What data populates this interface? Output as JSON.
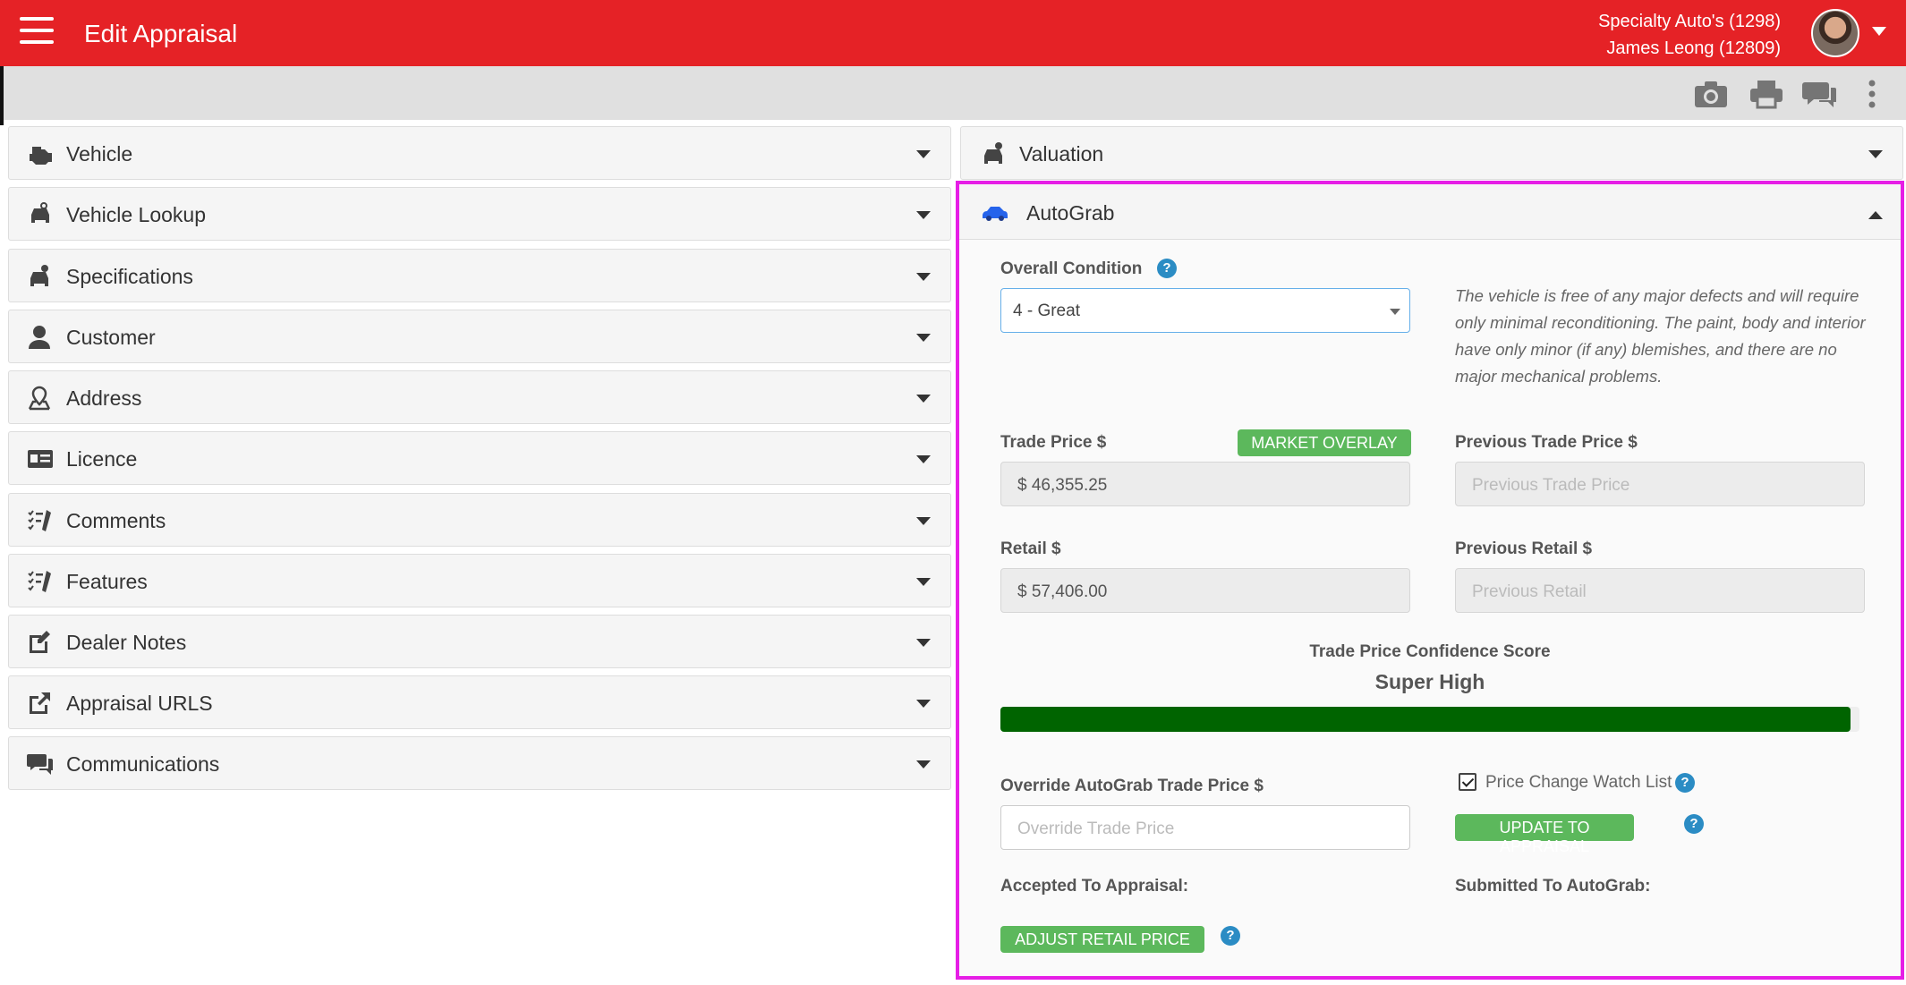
{
  "header": {
    "title": "Edit Appraisal",
    "dealer": "Specialty Auto's (1298)",
    "user": "James Leong (12809)"
  },
  "toolbar": {
    "icons": [
      "camera-icon",
      "print-icon",
      "chat-icon",
      "more-vert-icon"
    ]
  },
  "sidebar": {
    "items": [
      {
        "label": "Vehicle",
        "icon": "engine-icon"
      },
      {
        "label": "Vehicle Lookup",
        "icon": "car-search-icon"
      },
      {
        "label": "Specifications",
        "icon": "car-gear-icon"
      },
      {
        "label": "Customer",
        "icon": "user-icon"
      },
      {
        "label": "Address",
        "icon": "location-icon"
      },
      {
        "label": "Licence",
        "icon": "id-card-icon"
      },
      {
        "label": "Comments",
        "icon": "checklist-pen-icon"
      },
      {
        "label": "Features",
        "icon": "checklist-pen-icon"
      },
      {
        "label": "Dealer Notes",
        "icon": "edit-note-icon"
      },
      {
        "label": "Appraisal URLS",
        "icon": "external-link-icon"
      },
      {
        "label": "Communications",
        "icon": "chat-icon"
      }
    ]
  },
  "valuation": {
    "title": "Valuation"
  },
  "autograb": {
    "title": "AutoGrab",
    "overall_condition_label": "Overall Condition",
    "overall_condition_value": "4 - Great",
    "condition_description": "The vehicle is free of any major defects and will require only minimal reconditioning. The paint, body and interior have only minor (if any) blemishes, and there are no major mechanical problems.",
    "trade_price_label": "Trade Price $",
    "market_overlay_label": "MARKET OVERLAY",
    "trade_price_value": "$ 46,355.25",
    "previous_trade_price_label": "Previous Trade Price $",
    "previous_trade_price_placeholder": "Previous Trade Price",
    "retail_label": "Retail $",
    "retail_value": "$ 57,406.00",
    "previous_retail_label": "Previous Retail $",
    "previous_retail_placeholder": "Previous Retail",
    "confidence_title": "Trade Price Confidence Score",
    "confidence_value": "Super High",
    "confidence_level": 0.99,
    "confidence_color": "#006400",
    "override_label": "Override AutoGrab Trade Price $",
    "override_placeholder": "Override Trade Price",
    "watch_list_label": "Price Change Watch List",
    "watch_list_checked": true,
    "update_button_label": "UPDATE TO APPRAISAL",
    "accepted_label": "Accepted To Appraisal:",
    "submitted_label": "Submitted To AutoGrab:",
    "adjust_button_label": "ADJUST RETAIL PRICE"
  },
  "colors": {
    "brand_red": "#e52226",
    "highlight_magenta": "#e61ee6",
    "badge_green": "#5cb85c",
    "help_blue": "#2b8cc4"
  }
}
